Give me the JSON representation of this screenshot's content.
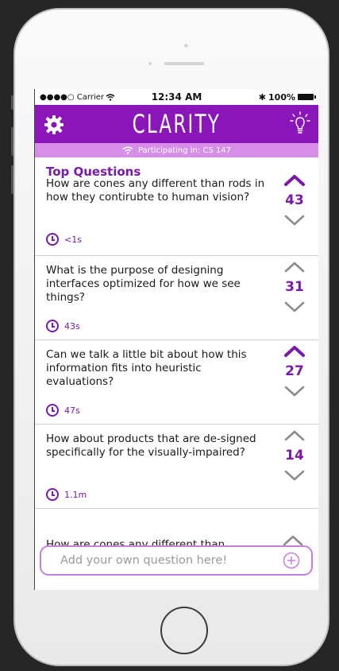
{
  "status": {
    "carrier": "●●●●○ Carrier",
    "time": "12:34 AM",
    "bluetooth": "✱",
    "battery_pct": "100%"
  },
  "app": {
    "title": "CLARITY",
    "participating": "Participating in: CS 147",
    "icons": {
      "settings": "gear-icon",
      "ideas": "lightbulb-icon"
    },
    "accent": "#8a15b8"
  },
  "section_title": "Top Questions",
  "questions": [
    {
      "text": "How are cones any different than rods in how they contirubte to human vision?",
      "votes": "43",
      "time": "<1s",
      "upvoted": true
    },
    {
      "text": "What is the purpose of designing interfaces optimized for how we see things?",
      "votes": "31",
      "time": "43s",
      "upvoted": false
    },
    {
      "text": "Can we talk a little bit about how this information fits into heuristic evaluations?",
      "votes": "27",
      "time": "47s",
      "upvoted": true
    },
    {
      "text": "How about products that are de-signed specifically for the visually-impaired?",
      "votes": "14",
      "time": "1.1m",
      "upvoted": false
    }
  ],
  "partial_question": "How are cones any different than",
  "composer": {
    "placeholder": "Add your own question here!"
  }
}
